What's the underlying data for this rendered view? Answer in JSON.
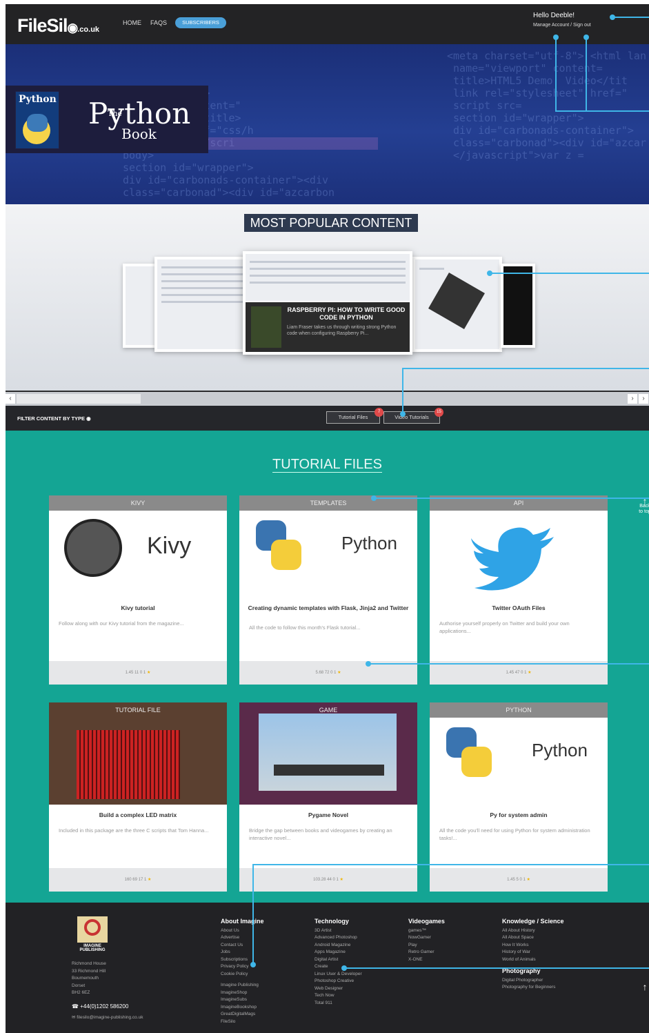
{
  "header": {
    "logo_main": "FileSil",
    "logo_suffix": ".co.uk",
    "nav": [
      "HOME",
      "FAQs"
    ],
    "subscribers_label": "SUBSCRIBERS",
    "greeting": "Hello Deeble!",
    "account_links": "Manage Account / Sign out"
  },
  "hero": {
    "book_small_title": "Python",
    "book_the": "The",
    "book_title": "Python",
    "book_subtitle": "Book"
  },
  "popular": {
    "heading": "MOST POPULAR CONTENT",
    "featured_title": "RASPBERRY PI: HOW TO WRITE GOOD CODE IN PYTHON",
    "featured_desc": "Liam Fraser takes us through writing strong Python code when configuring Raspberry Pi..."
  },
  "filter": {
    "label": "FILTER CONTENT BY TYPE",
    "buttons": [
      {
        "label": "Tutorial Files",
        "count": "7"
      },
      {
        "label": "Video Tutorials",
        "count": "15"
      }
    ]
  },
  "tutorials": {
    "heading": "TUTORIAL FILES",
    "cards": [
      {
        "category": "KIVY",
        "image_text": "Kivy",
        "title": "Kivy tutorial",
        "desc": "Follow along with our Kivy tutorial from the magazine...",
        "stats": "1.45   11   0   1"
      },
      {
        "category": "TEMPLATES",
        "image_text": "Python",
        "title": "Creating dynamic templates with Flask, Jinja2 and Twitter",
        "desc": "All the code to follow this month's Flask tutorial...",
        "stats": "5.68   72   0   1"
      },
      {
        "category": "API",
        "image_text": "",
        "title": "Twitter OAuth Files",
        "desc": "Authorise yourself properly on Twitter and build your own applications...",
        "stats": "1.45   47   0   1"
      },
      {
        "category": "TUTORIAL FILE",
        "image_text": "",
        "title": "Build a complex LED matrix",
        "desc": "Included in this package are the three C scripts that Tom Hanna...",
        "stats": "160   69   17   1"
      },
      {
        "category": "GAME",
        "image_text": "",
        "title": "Pygame Novel",
        "desc": "Bridge the gap between books and videogames by creating an interactive novel...",
        "stats": "103.28   44   0   1"
      },
      {
        "category": "PYTHON",
        "image_text": "Python",
        "title": "Py for system admin",
        "desc": "All the code you'll need for using Python for system administration tasks!...",
        "stats": "1.45   5   0   1"
      }
    ],
    "back_to_top": "Back to top"
  },
  "footer": {
    "publisher_name": "IMAGINE PUBLISHING",
    "address": [
      "Richmond House",
      "33 Richmond Hill",
      "Bournemouth",
      "Dorset",
      "BH2 6EZ"
    ],
    "phone": "+44(0)1202 586200",
    "email": "filesilo@imagine-publishing.co.uk",
    "columns": [
      {
        "heading": "About Imagine",
        "links": [
          "About Us",
          "Advertise",
          "Contact Us",
          "Jobs",
          "Subscriptions",
          "Privacy Policy",
          "Cookie Policy",
          "",
          "Imagine Publishing",
          "ImagineShop",
          "ImagineSubs",
          "ImagineBookshop",
          "GreatDigitalMags",
          "FileSilo"
        ]
      },
      {
        "heading": "Technology",
        "links": [
          "3D Artist",
          "Advanced Photoshop",
          "Android Magazine",
          "Apps Magazine",
          "Digital Artist",
          "Create",
          "Linux User & Developer",
          "Photoshop Creative",
          "Web Designer",
          "Tech Now",
          "Total 911"
        ]
      },
      {
        "heading": "Videogames",
        "links": [
          "games™",
          "NowGamer",
          "Play",
          "Retro Gamer",
          "X-ONE"
        ]
      },
      {
        "heading": "Knowledge / Science",
        "links": [
          "All About History",
          "All About Space",
          "How It Works",
          "History of War",
          "World of Animals"
        ]
      },
      {
        "heading": "Photography",
        "links": [
          "Digital Photographer",
          "Photography for Beginners"
        ]
      }
    ]
  }
}
